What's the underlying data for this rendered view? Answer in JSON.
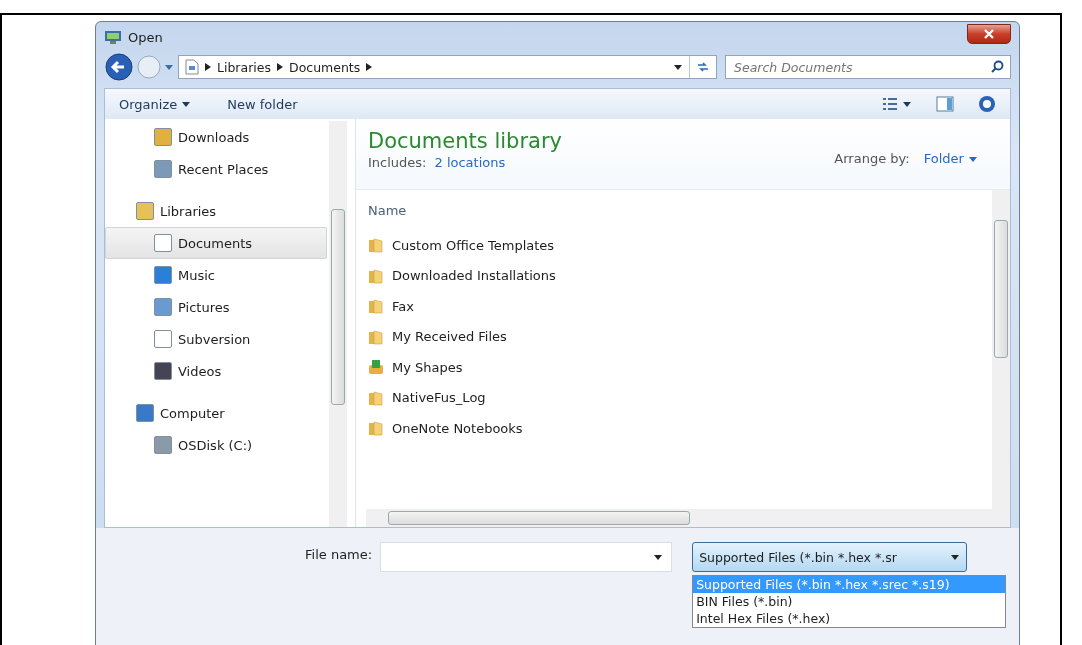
{
  "window": {
    "title": "Open"
  },
  "address_bar": {
    "path": [
      "Libraries",
      "Documents"
    ]
  },
  "search": {
    "placeholder": "Search Documents"
  },
  "toolbar": {
    "organize": "Organize",
    "new_folder": "New folder"
  },
  "navigation": {
    "sections": [
      {
        "items": [
          {
            "label": "Downloads",
            "kind": "downloads",
            "selected": false
          },
          {
            "label": "Recent Places",
            "kind": "recent",
            "selected": false
          }
        ]
      },
      {
        "header": {
          "label": "Libraries",
          "kind": "library",
          "selected": false
        },
        "items": [
          {
            "label": "Documents",
            "kind": "document",
            "selected": true
          },
          {
            "label": "Music",
            "kind": "music",
            "selected": false
          },
          {
            "label": "Pictures",
            "kind": "pictures",
            "selected": false
          },
          {
            "label": "Subversion",
            "kind": "document",
            "selected": false
          },
          {
            "label": "Videos",
            "kind": "videos",
            "selected": false
          }
        ]
      },
      {
        "header": {
          "label": "Computer",
          "kind": "computer",
          "selected": false
        },
        "items": [
          {
            "label": "OSDisk (C:)",
            "kind": "disk",
            "selected": false
          }
        ]
      }
    ]
  },
  "library": {
    "title": "Documents library",
    "includes_label": "Includes:",
    "locations_link": "2 locations",
    "arrange_label": "Arrange by:",
    "arrange_value": "Folder"
  },
  "file_list": {
    "columns": [
      "Name"
    ],
    "rows": [
      {
        "name": "Custom Office Templates",
        "kind": "folder"
      },
      {
        "name": "Downloaded Installations",
        "kind": "folder"
      },
      {
        "name": "Fax",
        "kind": "folder"
      },
      {
        "name": "My Received Files",
        "kind": "folder"
      },
      {
        "name": "My Shapes",
        "kind": "shapes"
      },
      {
        "name": "NativeFus_Log",
        "kind": "folder"
      },
      {
        "name": "OneNote Notebooks",
        "kind": "folder"
      }
    ]
  },
  "file_name": {
    "label": "File name:"
  },
  "file_type": {
    "value": "Supported Files (*.bin *.hex *.sr",
    "options": [
      {
        "label": "Supported Files (*.bin *.hex *.srec *.s19)",
        "selected": true
      },
      {
        "label": "BIN Files (*.bin)",
        "selected": false
      },
      {
        "label": "Intel Hex Files (*.hex)",
        "selected": false
      }
    ]
  }
}
